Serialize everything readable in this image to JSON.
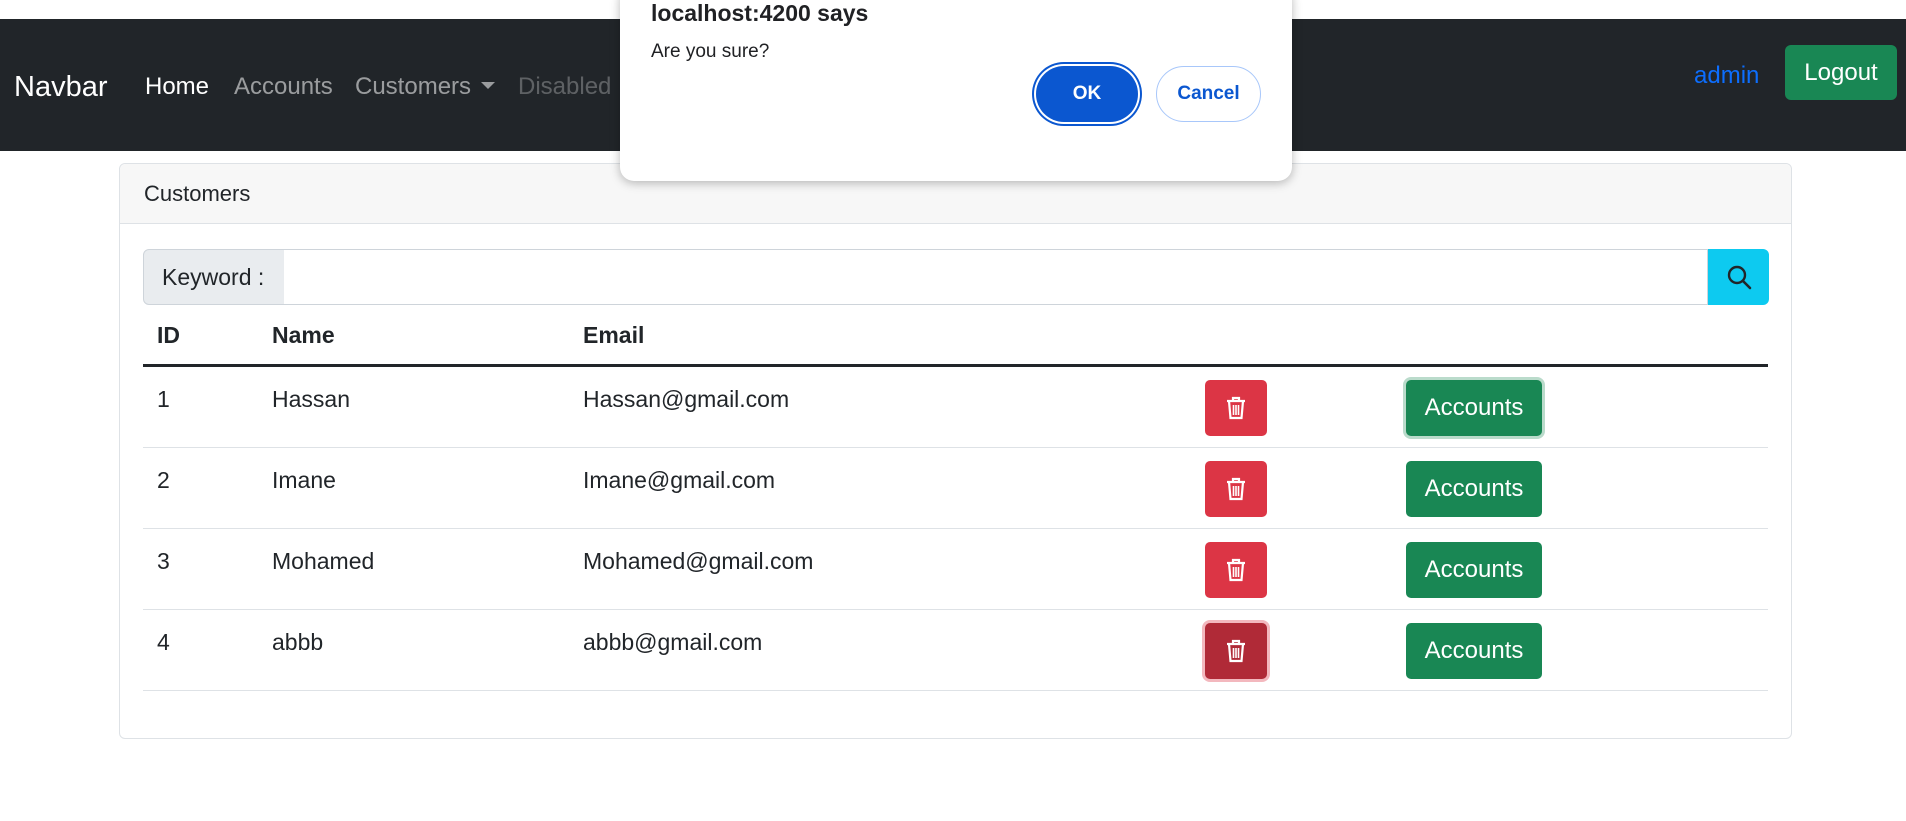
{
  "navbar": {
    "brand": "Navbar",
    "links": [
      {
        "label": "Home"
      },
      {
        "label": "Accounts"
      },
      {
        "label": "Customers"
      },
      {
        "label": "Disabled"
      }
    ],
    "user": "admin",
    "logout_label": "Logout"
  },
  "card": {
    "title": "Customers"
  },
  "search": {
    "label": "Keyword :",
    "value": "",
    "button_icon": "search-icon"
  },
  "table": {
    "headers": [
      "ID",
      "Name",
      "Email"
    ],
    "rows": [
      {
        "id": "1",
        "name": "Hassan",
        "email": "Hassan@gmail.com",
        "action": "Accounts"
      },
      {
        "id": "2",
        "name": "Imane",
        "email": "Imane@gmail.com",
        "action": "Accounts"
      },
      {
        "id": "3",
        "name": "Mohamed",
        "email": "Mohamed@gmail.com",
        "action": "Accounts"
      },
      {
        "id": "4",
        "name": "abbb",
        "email": "abbb@gmail.com",
        "action": "Accounts"
      }
    ],
    "delete_icon": "trash-icon"
  },
  "dialog": {
    "title": "localhost:4200 says",
    "message": "Are you sure?",
    "ok_label": "OK",
    "cancel_label": "Cancel"
  },
  "colors": {
    "navbar_bg": "#212529",
    "success": "#198754",
    "danger": "#dc3545",
    "info": "#0dcaf0",
    "primary": "#0d6efd",
    "dialog_primary": "#0b57d0"
  }
}
